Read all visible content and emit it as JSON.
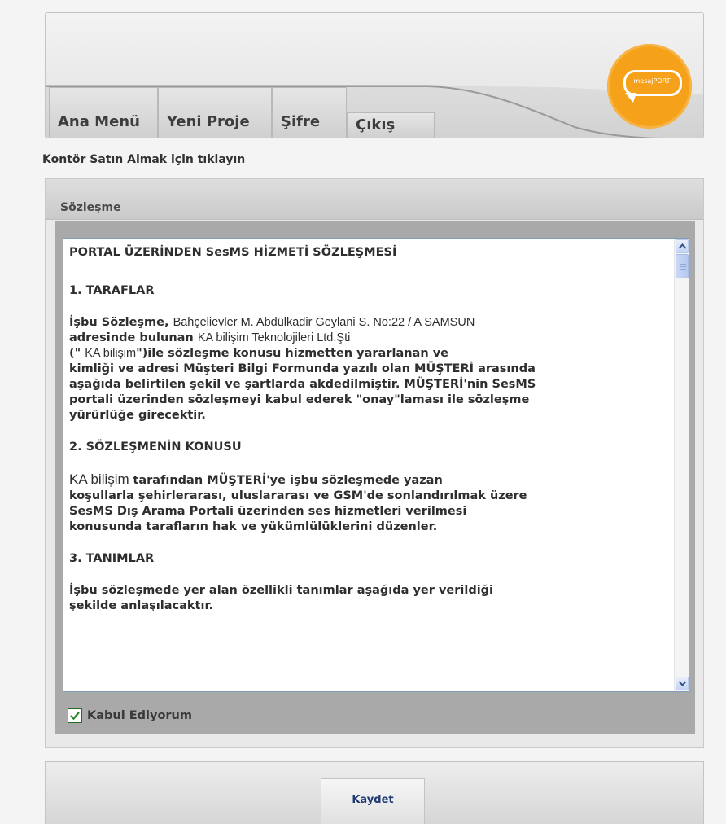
{
  "logo": {
    "text": "mesajPORT"
  },
  "nav": {
    "tabs": [
      {
        "label": "Ana Menü"
      },
      {
        "label": "Yeni Proje"
      },
      {
        "label": "Şifre"
      },
      {
        "label": "Çıkış"
      }
    ]
  },
  "kontor_link": "Kontör Satın Almak için tıklayın",
  "panel": {
    "title": "Sözleşme",
    "agreement": {
      "heading": "PORTAL ÜZERİNDEN SesMS HİZMETİ SÖZLEŞMESİ",
      "s1_title": "1. TARAFLAR",
      "s1_lead": "İşbu Sözleşme, ",
      "s1_address": "Bahçelievler M. Abdülkadir Geylani S. No:22 / A SAMSUN",
      "s1_b": "adresinde bulunan ",
      "s1_company": "KA bilişim Teknolojileri Ltd.Şti",
      "s1_c_open": "(\" ",
      "s1_c_name": "KA bilişim",
      "s1_rest": "\")ile sözleşme konusu hizmetten yararlanan ve\nkimliği ve adresi Müşteri Bilgi Formunda yazılı olan MÜŞTERİ arasında\naşağıda belirtilen şekil ve şartlarda akdedilmiştir. MÜŞTERİ'nin SesMS\nportali üzerinden  sözleşmeyi kabul ederek \"onay\"laması ile sözleşme\nyürürlüğe girecektir.",
      "s2_title": "2. SÖZLEŞMENİN KONUSU",
      "s2_company": "KA bilişim ",
      "s2_rest": "tarafından MÜŞTERİ'ye işbu sözleşmede yazan\nkoşullarla  şehirlerarası, uluslararası ve GSM'de sonlandırılmak üzere\nSesMS Dış Arama Portali üzerinden ses  hizmetleri verilmesi\nkonusunda tarafların hak ve yükümlülüklerini düzenler.",
      "s3_title": "3. TANIMLAR",
      "s3_text": "İşbu sözleşmede yer alan özellikli tanımlar aşağıda yer verildiği\nşekilde anlaşılacaktır."
    },
    "accept_label": "Kabul Ediyorum",
    "accept_checked": true
  },
  "save_label": "Kaydet",
  "colors": {
    "logo": "#f5a21a",
    "link_text": "#1f3a73",
    "check": "#2a8a2a"
  }
}
